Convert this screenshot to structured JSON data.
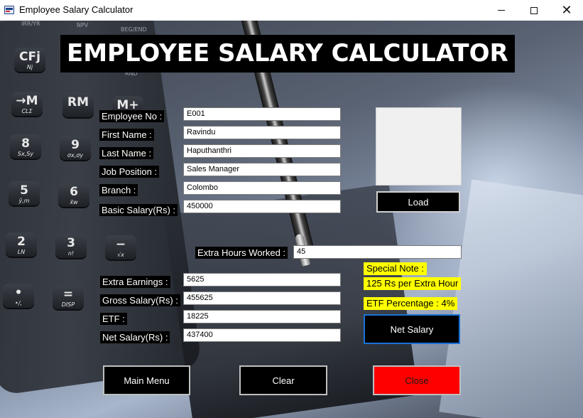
{
  "window": {
    "title": "Employee Salary Calculator"
  },
  "heading": "EMPLOYEE SALARY CALCULATOR",
  "background_keys": {
    "top_row": [
      "IRR/YR",
      "NPV",
      "BEG/END"
    ],
    "cfj": "CFj",
    "nj": "Nj",
    "rnd": "RND",
    "arrow_m": "→M",
    "cl_sigma": "CLΣ",
    "rm": "RM",
    "m_plus": "M+",
    "k8": "8",
    "k8_sub": "Sx,Sy",
    "k9": "9",
    "k9_sub": "σx,σy",
    "k5": "5",
    "k5_sub": "ŷ,m",
    "k6": "6",
    "k6_sub": "x̄w",
    "k2": "2",
    "k2_sub": "LN",
    "k3": "3",
    "k3_sub": "n!",
    "dot": "•",
    "dot_sub": "•/,",
    "eq": "=",
    "eq_sub": "DISP",
    "minus_sub": "√x"
  },
  "form": {
    "employee_no": {
      "label": "Employee No :",
      "value": "E001"
    },
    "first_name": {
      "label": "First Name :",
      "value": "Ravindu"
    },
    "last_name": {
      "label": "Last Name :",
      "value": "Haputhanthri"
    },
    "job_position": {
      "label": "Job Position :",
      "value": "Sales Manager"
    },
    "branch": {
      "label": "Branch :",
      "value": "Colombo"
    },
    "basic_salary": {
      "label": "Basic Salary(Rs) :",
      "value": "450000"
    },
    "extra_hours": {
      "label": "Extra Hours Worked :",
      "value": "45"
    },
    "extra_earnings": {
      "label": "Extra Earnings :",
      "value": "5625"
    },
    "gross_salary": {
      "label": "Gross Salary(Rs) :",
      "value": "455625"
    },
    "etf": {
      "label": "ETF :",
      "value": "18225"
    },
    "net_salary": {
      "label": "Net Salary(Rs) :",
      "value": "437400"
    }
  },
  "notes": {
    "special_note": "Special Note :",
    "rate": "125 Rs per Extra Hour",
    "etf_percentage": "ETF Percentage : 4%"
  },
  "buttons": {
    "load": "Load",
    "net_salary": "Net Salary",
    "main_menu": "Main Menu",
    "clear": "Clear",
    "close": "Close"
  },
  "colors": {
    "close_button": "#ff0000",
    "note_background": "#ffff00",
    "net_salary_border": "#1a73d9"
  }
}
